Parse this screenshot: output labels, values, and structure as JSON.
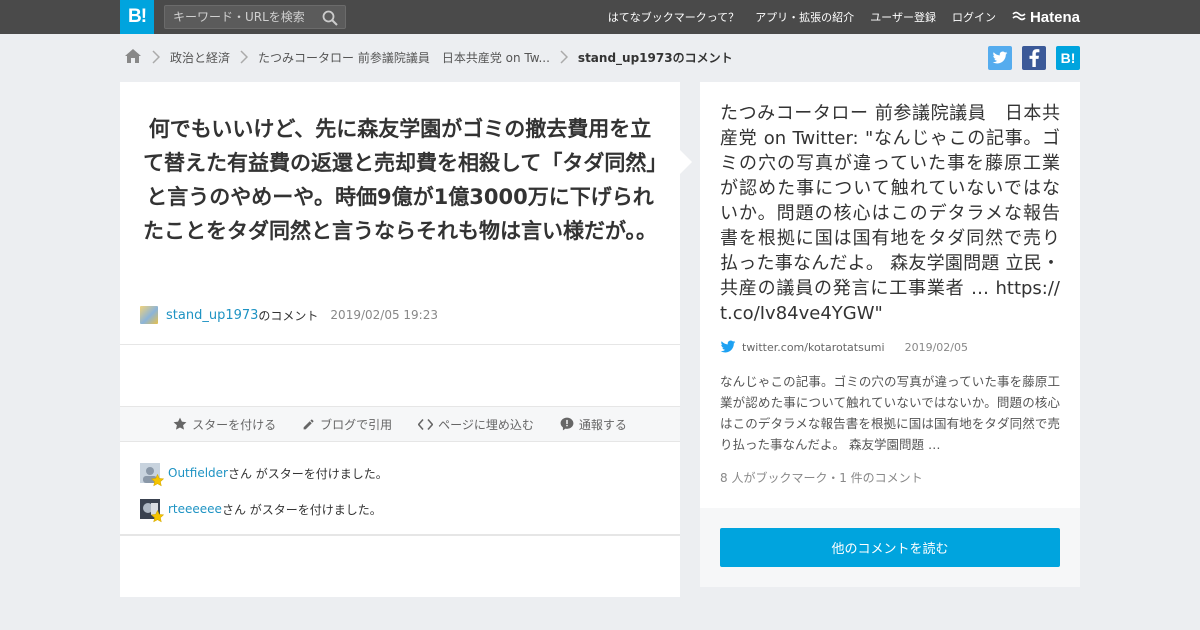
{
  "topbar": {
    "logo": "B!",
    "search_placeholder": "キーワード・URLを検索",
    "nav": [
      "はてなブックマークって？",
      "アプリ・拡張の紹介",
      "ユーザー登録",
      "ログイン"
    ],
    "hatena_logo": "Hatena"
  },
  "breadcrumb": {
    "items": [
      "政治と経済",
      "たつみコータロー 前参議院議員　日本共産党 on Tw...",
      "stand_up1973のコメント"
    ]
  },
  "share": {
    "hatena_label": "B!"
  },
  "comment": {
    "text": "何でもいいけど、先に森友学園がゴミの撤去費用を立て替えた有益費の返還と売却費を相殺して「タダ同然」と言うのやめーや。時価9億が1億3000万に下げられたことをタダ同然と言うならそれも物は言い様だが。。",
    "username": "stand_up1973",
    "suffix": "のコメント",
    "date": "2019/02/05 19:23"
  },
  "actions": {
    "star": "スターを付ける",
    "blog": "ブログで引用",
    "embed": "ページに埋め込む",
    "report": "通報する"
  },
  "stars": [
    {
      "user": "Outfielder",
      "text": "さん がスターを付けました。"
    },
    {
      "user": "rteeeeee",
      "text": "さん がスターを付けました。"
    }
  ],
  "entry": {
    "title": "たつみコータロー 前参議院議員　日本共産党 on Twitter: \"なんじゃこの記事。ゴミの穴の写真が違っていた事を藤原工業が認めた事について触れていないではないか。問題の核心はこのデタラメな報告書を根拠に国は国有地をタダ同然で売り払った事なんだよ。 森友学園問題 立民・共産の議員の発言に工事業者 … https://t.co/Iv84ve4YGW\"",
    "source": "twitter.com/kotarotatsumi",
    "date": "2019/02/05",
    "summary": "なんじゃこの記事。ゴミの穴の写真が違っていた事を藤原工業が認めた事について触れていないではないか。問題の核心はこのデタラメな報告書を根拠に国は国有地をタダ同然で売り払った事なんだよ。 森友学園問題 …",
    "bookmark_count": "8 人がブックマーク・1 件のコメント",
    "read_more": "他のコメントを読む"
  },
  "colors": {
    "topbar": "#4a4a4a",
    "brand": "#00a4de",
    "link": "#1e93c3",
    "twitter": "#55acee",
    "facebook": "#3b5998",
    "background": "#eceef1"
  }
}
